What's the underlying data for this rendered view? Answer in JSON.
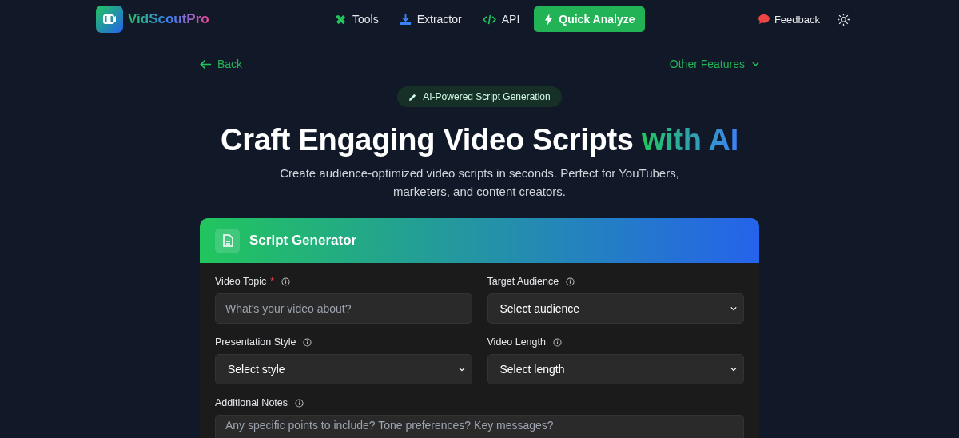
{
  "brand": {
    "name": "VidScoutPro"
  },
  "nav": {
    "links": [
      {
        "label": "Tools"
      },
      {
        "label": "Extractor"
      },
      {
        "label": "API"
      }
    ],
    "cta": "Quick Analyze",
    "feedback": "Feedback"
  },
  "back": "Back",
  "other_features": "Other Features",
  "badge": "AI-Powered Script Generation",
  "headline": {
    "main": "Craft Engaging Video Scripts ",
    "accent": "with AI"
  },
  "subtitle": "Create audience-optimized video scripts in seconds. Perfect for YouTubers, marketers, and content creators.",
  "card": {
    "title": "Script Generator",
    "fields": [
      {
        "kind": "text",
        "label": "Video Topic",
        "required_mark": "*",
        "placeholder": "What's your video about?"
      },
      {
        "kind": "select",
        "label": "Target Audience",
        "value": "Select audience"
      },
      {
        "kind": "select",
        "label": "Presentation Style",
        "value": "Select style"
      },
      {
        "kind": "select",
        "label": "Video Length",
        "value": "Select length"
      },
      {
        "kind": "textarea",
        "label": "Additional Notes",
        "placeholder": "Any specific points to include? Tone preferences? Key messages?"
      }
    ]
  }
}
